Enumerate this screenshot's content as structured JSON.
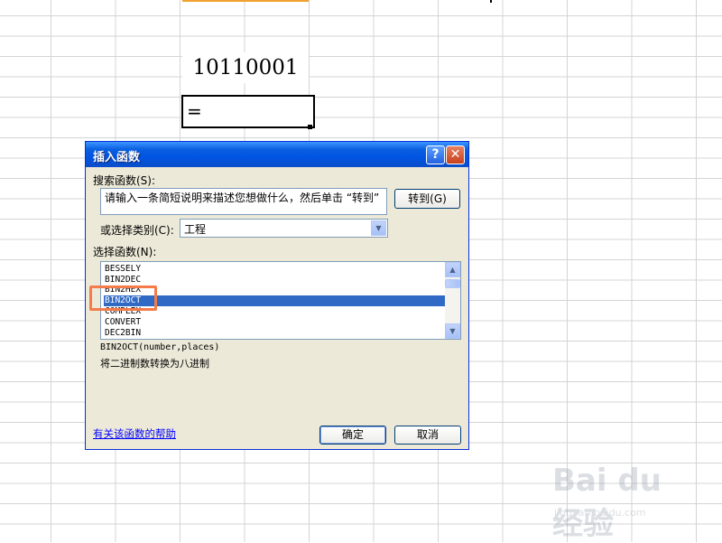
{
  "sheet": {
    "cell_value": "10110001",
    "active_cell_content": "="
  },
  "dialog": {
    "title": "插入函数",
    "help_button": "?",
    "close_button": "✕",
    "search_label": "搜索函数(S):",
    "search_value": "请输入一条简短说明来描述您想做什么，然后单击 “转到”",
    "goto_label": "转到(G)",
    "category_label": "或选择类别(C):",
    "category_value": "工程",
    "function_label": "选择函数(N):",
    "functions": [
      "BESSELY",
      "BIN2DEC",
      "BIN2HEX",
      "BIN2OCT",
      "COMPLEX",
      "CONVERT",
      "DEC2BIN"
    ],
    "selected_function": "BIN2OCT",
    "syntax": "BIN2OCT(number,places)",
    "description": "将二进制数转换为八进制",
    "help_link": "有关该函数的帮助",
    "ok_label": "确定",
    "cancel_label": "取消"
  },
  "watermark": {
    "logo": "Bai du 经验",
    "url": "jingyan.baidu.com"
  },
  "colors": {
    "title_bar": "#0054e3",
    "selection": "#316ac5",
    "highlight": "#f47b4a",
    "dialog_bg": "#ece9d8"
  },
  "icons": {
    "dropdown": "chevron-down-icon",
    "scroll_up": "arrow-up-icon",
    "scroll_down": "arrow-down-icon"
  }
}
